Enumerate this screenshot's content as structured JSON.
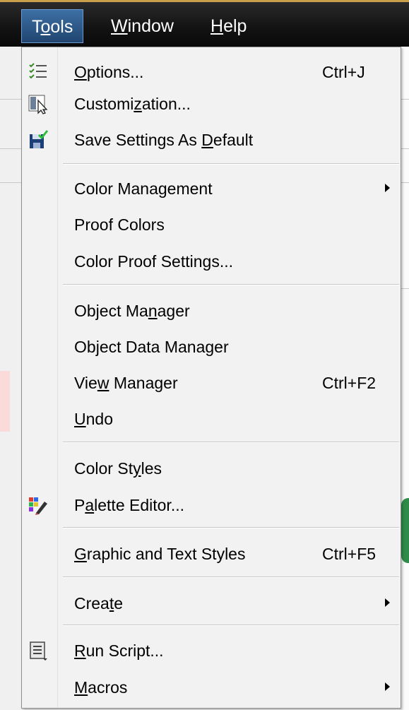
{
  "menubar": {
    "items": [
      {
        "pre": "T",
        "u": "o",
        "post": "ols",
        "active": true
      },
      {
        "pre": "",
        "u": "W",
        "post": "indow",
        "active": false
      },
      {
        "pre": "",
        "u": "H",
        "post": "elp",
        "active": false
      }
    ]
  },
  "menu": {
    "items": [
      {
        "key": "options",
        "pre": "",
        "u": "O",
        "post": "ptions...",
        "shortcut": "Ctrl+J",
        "icon": "options-checklist-icon"
      },
      {
        "key": "customization",
        "pre": "Customi",
        "u": "z",
        "post": "ation...",
        "icon": "customization-icon"
      },
      {
        "key": "save-settings",
        "pre": "Save Settings As ",
        "u": "D",
        "post": "efault",
        "icon": "save-settings-icon"
      },
      {
        "sep": true
      },
      {
        "key": "color-management",
        "pre": "Color Management",
        "u": "",
        "post": "",
        "submenu": true
      },
      {
        "key": "proof-colors",
        "pre": "Proof Colors",
        "u": "",
        "post": ""
      },
      {
        "key": "color-proof-settings",
        "pre": "Color Proof Settings...",
        "u": "",
        "post": ""
      },
      {
        "sep": true
      },
      {
        "key": "object-manager",
        "pre": "Object Ma",
        "u": "n",
        "post": "ager"
      },
      {
        "key": "object-data-manager",
        "pre": "Ob",
        "u": "j",
        "post": "ect Data Manager"
      },
      {
        "key": "view-manager",
        "pre": "Vie",
        "u": "w",
        "post": " Manager",
        "shortcut": "Ctrl+F2"
      },
      {
        "key": "undo",
        "pre": "",
        "u": "U",
        "post": "ndo"
      },
      {
        "sep": true
      },
      {
        "key": "color-styles",
        "pre": "Color St",
        "u": "y",
        "post": "les"
      },
      {
        "key": "palette-editor",
        "pre": "P",
        "u": "a",
        "post": "lette Editor...",
        "icon": "palette-editor-icon"
      },
      {
        "sep": true
      },
      {
        "key": "graphic-text-styles",
        "pre": "",
        "u": "G",
        "post": "raphic and Text Styles",
        "shortcut": "Ctrl+F5"
      },
      {
        "sep": true
      },
      {
        "key": "create",
        "pre": "Crea",
        "u": "t",
        "post": "e",
        "submenu": true
      },
      {
        "sep": true
      },
      {
        "key": "run-script",
        "pre": "",
        "u": "R",
        "post": "un Script...",
        "icon": "run-script-icon"
      },
      {
        "key": "macros",
        "pre": "",
        "u": "M",
        "post": "acros",
        "submenu": true
      }
    ]
  }
}
